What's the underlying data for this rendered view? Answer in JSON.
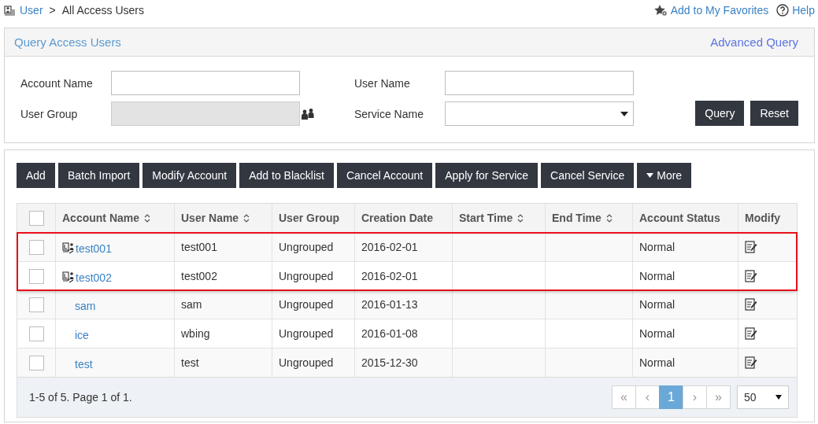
{
  "breadcrumb": {
    "root": "User",
    "separator": ">",
    "current": "All Access Users"
  },
  "top_links": {
    "favorites": "Add to My Favorites",
    "help": "Help"
  },
  "query_panel": {
    "title": "Query Access Users",
    "advanced": "Advanced Query",
    "fields": [
      {
        "label": "Account Name",
        "kind": "text",
        "disabled": false
      },
      {
        "label": "User Name",
        "kind": "text",
        "disabled": false
      },
      {
        "label": "User Group",
        "kind": "picker",
        "disabled": true
      },
      {
        "label": "Service Name",
        "kind": "select",
        "disabled": false
      }
    ],
    "buttons": [
      "Query",
      "Reset"
    ]
  },
  "toolbar": [
    {
      "label": "Add",
      "kind": "plain"
    },
    {
      "label": "Batch Import",
      "kind": "plain"
    },
    {
      "label": "Modify Account",
      "kind": "plain"
    },
    {
      "label": "Add to Blacklist",
      "kind": "plain"
    },
    {
      "label": "Cancel Account",
      "kind": "plain"
    },
    {
      "label": "Apply for Service",
      "kind": "plain"
    },
    {
      "label": "Cancel Service",
      "kind": "plain"
    },
    {
      "label": "More",
      "kind": "dropdown"
    }
  ],
  "table": {
    "columns": [
      {
        "label": "Account Name",
        "sortable": true
      },
      {
        "label": "User Name",
        "sortable": true
      },
      {
        "label": "User Group",
        "sortable": false
      },
      {
        "label": "Creation Date",
        "sortable": false
      },
      {
        "label": "Start Time",
        "sortable": true
      },
      {
        "label": "End Time",
        "sortable": true
      },
      {
        "label": "Account Status",
        "sortable": false
      },
      {
        "label": "Modify",
        "sortable": false
      }
    ],
    "rows": [
      {
        "account": "test001",
        "account_icon": true,
        "user": "test001",
        "group": "Ungrouped",
        "created": "2016-02-01",
        "status": "Normal",
        "checked": false,
        "highlighted": true
      },
      {
        "account": "test002",
        "account_icon": true,
        "user": "test002",
        "group": "Ungrouped",
        "created": "2016-02-01",
        "status": "Normal",
        "checked": false,
        "highlighted": true
      },
      {
        "account": "sam",
        "account_icon": false,
        "user": "sam",
        "group": "Ungrouped",
        "created": "2016-01-13",
        "status": "Normal",
        "checked": false,
        "highlighted": false
      },
      {
        "account": "ice",
        "account_icon": false,
        "user": "wbing",
        "group": "Ungrouped",
        "created": "2016-01-08",
        "status": "Normal",
        "checked": false,
        "highlighted": false
      },
      {
        "account": "test",
        "account_icon": false,
        "user": "test",
        "group": "Ungrouped",
        "created": "2015-12-30",
        "status": "Normal",
        "checked": false,
        "highlighted": false
      }
    ],
    "select_all": {
      "checked": false
    }
  },
  "footer": {
    "summary": "1-5 of 5. Page 1 of 1.",
    "pager": [
      {
        "label": "«",
        "selected": false
      },
      {
        "label": "‹",
        "selected": false
      },
      {
        "label": "1",
        "selected": true
      },
      {
        "label": "›",
        "selected": false
      },
      {
        "label": "»",
        "selected": false
      }
    ],
    "page_size": "50"
  }
}
